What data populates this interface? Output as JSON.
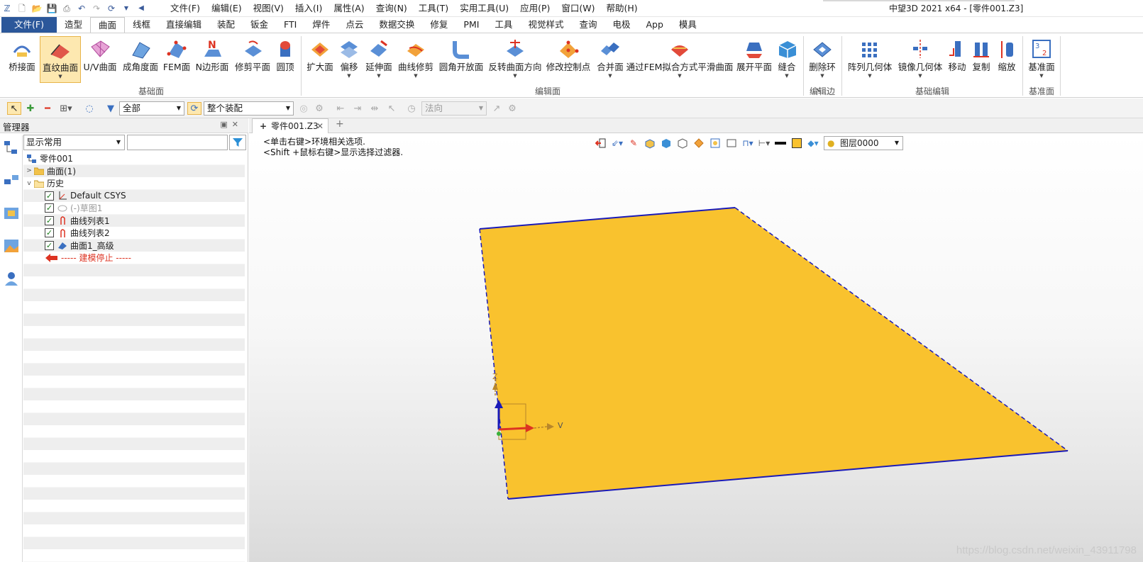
{
  "app": {
    "window_title": "中望3D 2021 x64 - [零件001.Z3]",
    "menus": [
      "文件(F)",
      "编辑(E)",
      "视图(V)",
      "插入(I)",
      "属性(A)",
      "查询(N)",
      "工具(T)",
      "实用工具(U)",
      "应用(P)",
      "窗口(W)",
      "帮助(H)"
    ]
  },
  "ribbon": {
    "tabs": [
      "文件(F)",
      "造型",
      "曲面",
      "线框",
      "直接编辑",
      "装配",
      "钣金",
      "FTI",
      "焊件",
      "点云",
      "数据交换",
      "修复",
      "PMI",
      "工具",
      "视觉样式",
      "查询",
      "电极",
      "App",
      "模具"
    ],
    "active_tab": "曲面",
    "buttons": [
      "桥接面",
      "直纹曲面",
      "U/V曲面",
      "成角度面",
      "FEM面",
      "N边形面",
      "修剪平面",
      "圆顶",
      "扩大面",
      "偏移",
      "延伸面",
      "曲线修剪",
      "圆角开放面",
      "反转曲面方向",
      "修改控制点",
      "合并面",
      "通过FEM拟合方式平滑曲面",
      "展开平面",
      "缝合",
      "删除环",
      "阵列几何体",
      "镜像几何体",
      "移动",
      "复制",
      "缩放",
      "基准面"
    ],
    "groups": [
      "基础面",
      "编辑面",
      "编辑边",
      "基础编辑",
      "基准面"
    ]
  },
  "filterbar": {
    "filter_value": "全部",
    "assembly_value": "整个装配",
    "direction_value": "法向"
  },
  "manager": {
    "title": "管理器",
    "combo_value": "显示常用",
    "tree": {
      "root": "零件001",
      "surface_folder": "曲面(1)",
      "history_folder": "历史",
      "items": [
        "Default CSYS",
        "(-)草图1",
        "曲线列表1",
        "曲线列表2",
        "曲面1_高级"
      ],
      "stop_marker": "----- 建模停止 -----"
    }
  },
  "document": {
    "tab_name": "零件001.Z3",
    "hint_line1": "<单击右键>环境相关选项.",
    "hint_line2": "<Shift +鼠标右键>显示选择过滤器.",
    "layer": "图层0000",
    "axis_labels": {
      "x": "V",
      "z": "Z"
    }
  },
  "colors": {
    "surface_fill": "#f9c22e",
    "surface_edge": "#1a1ab8",
    "accent": "#2b579a",
    "selected_bg": "#fde8b0"
  },
  "watermark": "https://blog.csdn.net/weixin_43911798"
}
